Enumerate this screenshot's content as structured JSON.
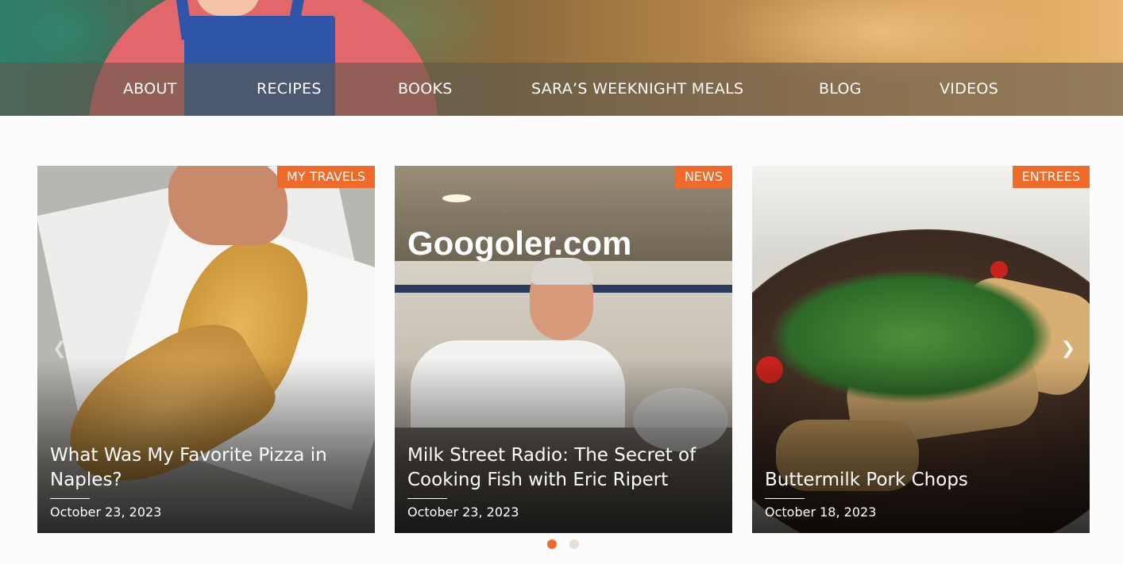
{
  "nav": {
    "items": [
      {
        "label": "ABOUT"
      },
      {
        "label": "RECIPES"
      },
      {
        "label": "BOOKS"
      },
      {
        "label": "SARA’S WEEKNIGHT MEALS"
      },
      {
        "label": "BLOG"
      },
      {
        "label": "VIDEOS"
      }
    ]
  },
  "carousel": {
    "cards": [
      {
        "category": "MY TRAVELS",
        "title": "What Was My Favorite Pizza in Naples?",
        "date": "October 23, 2023"
      },
      {
        "category": "NEWS",
        "title": "Milk Street Radio: The Secret of Cooking Fish with Eric Ripert",
        "date": "October 23, 2023",
        "watermark": "Googoler.com"
      },
      {
        "category": "ENTREES",
        "title": "Buttermilk Pork Chops",
        "date": "October 18, 2023"
      }
    ],
    "prev_icon": "chevron-left-icon",
    "next_icon": "chevron-right-icon",
    "active_page": 1,
    "page_count": 2
  },
  "colors": {
    "accent": "#f06a2a",
    "nav_overlay": "#5f584e",
    "page_background": "#fcfcfc"
  }
}
